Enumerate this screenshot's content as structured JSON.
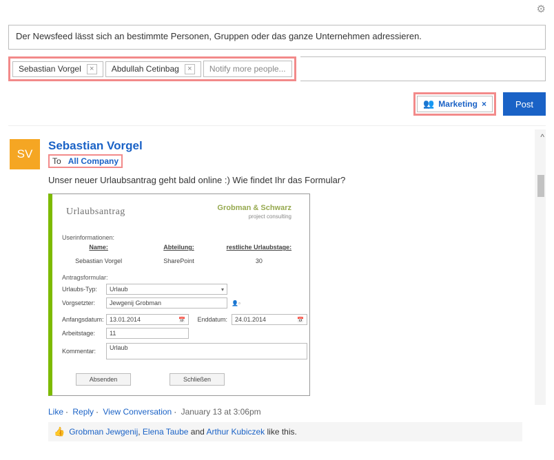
{
  "compose": {
    "text": "Der Newsfeed lässt sich an bestimmte Personen, Gruppen oder das ganze Unternehmen adressieren.",
    "chips": [
      "Sebastian Vorgel",
      "Abdullah Cetinbag"
    ],
    "notify_placeholder": "Notify more people...",
    "group_chip": "Marketing",
    "post_btn": "Post"
  },
  "post": {
    "avatar_initials": "SV",
    "author": "Sebastian Vorgel",
    "to_label": "To",
    "to_target": "All Company",
    "text": "Unser neuer Urlaubsantrag geht bald online :) Wie findet Ihr das Formular?",
    "actions": {
      "like": "Like",
      "reply": "Reply",
      "view": "View Conversation",
      "ts": "January 13 at 3:06pm"
    },
    "likes": {
      "p1": "Grobman Jewgenij",
      "p2": "Elena Taube",
      "and": " and ",
      "p3": "Arthur Kubiczek",
      "tail": " like this."
    }
  },
  "form": {
    "title": "Urlaubsantrag",
    "brand_top": "Grobman & Schwarz",
    "brand_sub": "project consulting",
    "userinfo_lbl": "Userinformationen:",
    "col_name": "Name:",
    "col_dept": "Abteilung:",
    "col_rest": "restliche Urlaubstage:",
    "val_name": "Sebastian Vorgel",
    "val_dept": "SharePoint",
    "val_rest": "30",
    "antrag_lbl": "Antragsformular:",
    "urlaubs_typ_lbl": "Urlaubs-Typ:",
    "urlaubs_typ_val": "Urlaub",
    "vorg_lbl": "Vorgsetzter:",
    "vorg_val": "Jewgenij Grobman",
    "anf_lbl": "Anfangsdatum:",
    "anf_val": "13.01.2014",
    "end_lbl": "Enddatum:",
    "end_val": "24.01.2014",
    "arb_lbl": "Arbeitstage:",
    "arb_val": "11",
    "kom_lbl": "Kommentar:",
    "kom_val": "Urlaub",
    "send": "Absenden",
    "close": "Schließen"
  }
}
